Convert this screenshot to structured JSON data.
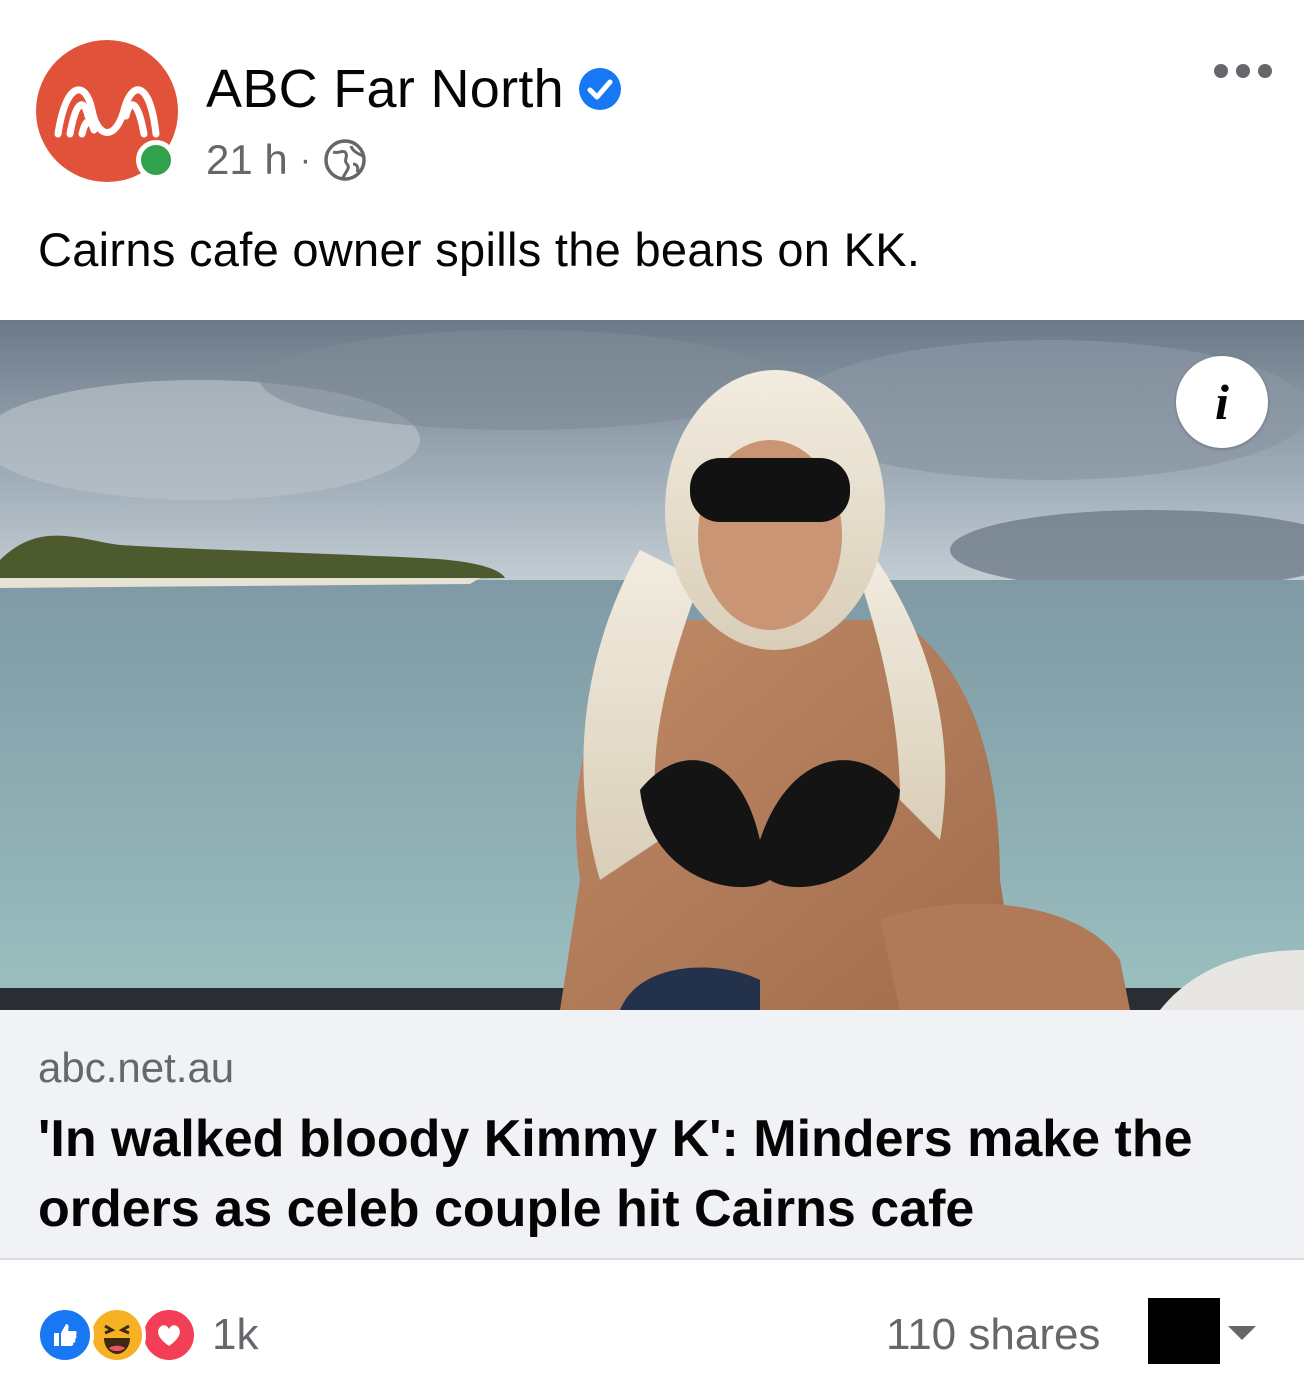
{
  "post": {
    "page_name": "ABC Far North",
    "timestamp": "21 h",
    "separator": "·",
    "audience_icon": "globe-icon",
    "verified_icon": "verified-badge-icon",
    "caption": "Cairns cafe owner spills the beans on KK.",
    "more_icon": "more-options-icon"
  },
  "media": {
    "info_label": "i"
  },
  "link_preview": {
    "domain": "abc.net.au",
    "headline": "'In walked bloody Kimmy K': Minders make the orders as celeb couple hit Cairns cafe"
  },
  "footer": {
    "reaction_icons": [
      "like-icon",
      "haha-icon",
      "love-icon"
    ],
    "reaction_count": "1k",
    "shares": "110 shares"
  },
  "colors": {
    "abc_brand": "#e0533a",
    "verified_blue": "#1877f2",
    "online_green": "#31a24c",
    "secondary_text": "#65676b",
    "link_bg": "#f0f2f5"
  }
}
